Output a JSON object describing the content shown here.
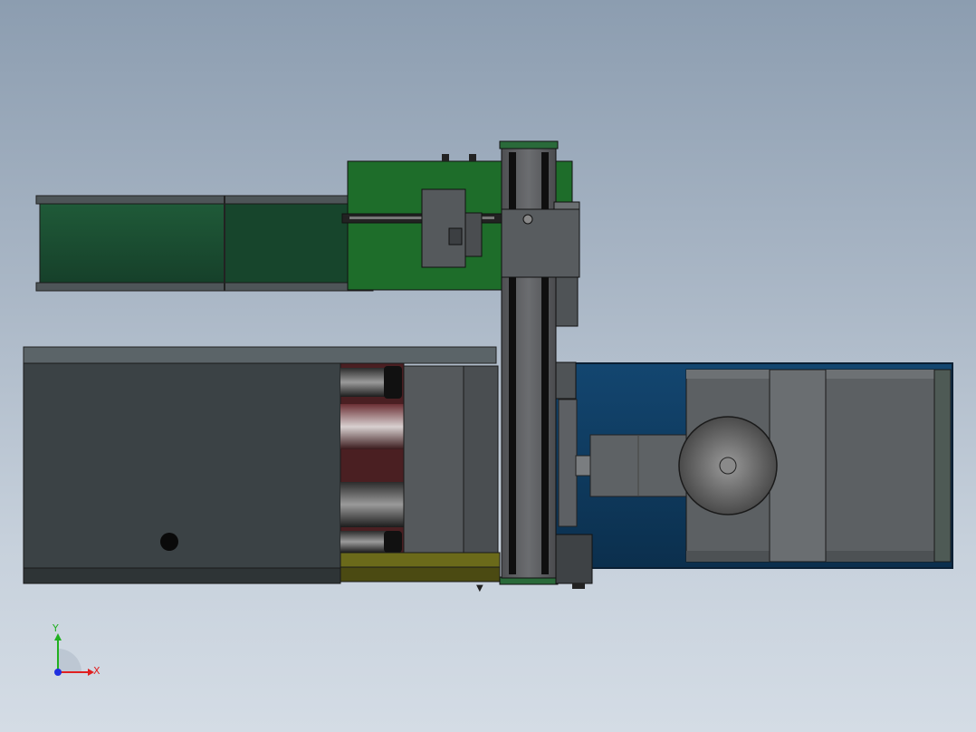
{
  "viewport": {
    "background_top": "#8c9db0",
    "background_bottom": "#d4dce5"
  },
  "triad": {
    "x_label": "X",
    "y_label": "Y",
    "x_color": "#e02020",
    "y_color": "#20b020",
    "z_color": "#2030e0"
  },
  "parts": {
    "feeder_tray": "#1d4f32",
    "pcb_plate": "#1e6d2a",
    "base_housing": "#3b4245",
    "motor_enclosure": "#0f3a5c",
    "rail_rod": "#6a6d60",
    "strip_olive": "#6b6a1a",
    "maroon_accent": "#4a1f22"
  }
}
